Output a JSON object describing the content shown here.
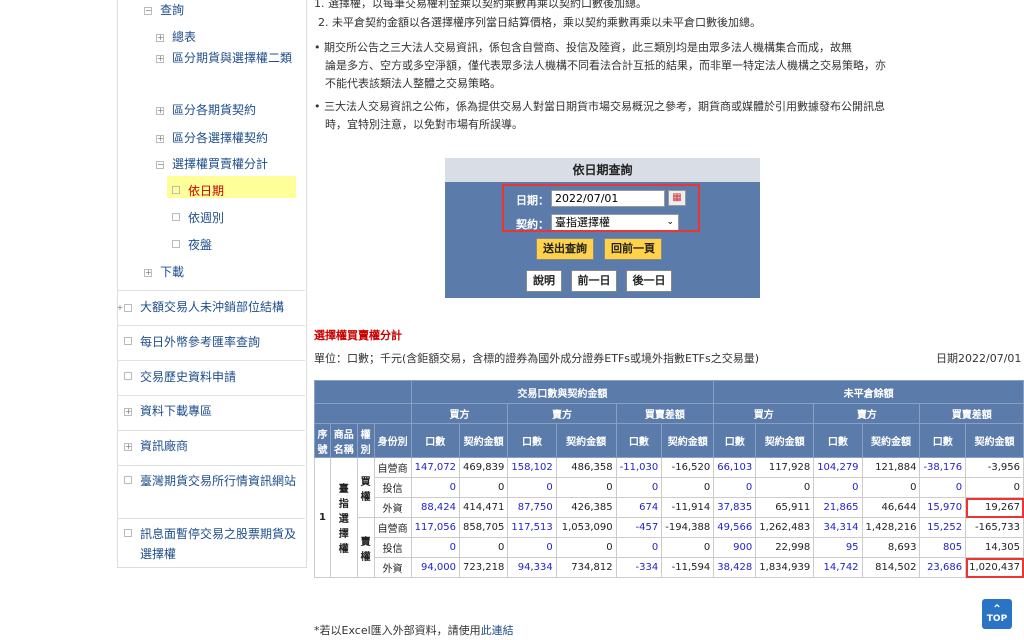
{
  "sidebar": {
    "items": [
      {
        "label": "查詢",
        "icon": "minus",
        "level": 1
      },
      {
        "label": "總表",
        "icon": "plus",
        "level": 2
      },
      {
        "label": "區分期貨與選擇權二類",
        "icon": "plus",
        "level": 2
      },
      {
        "label": "區分各期貨契約",
        "icon": "plus",
        "level": 2
      },
      {
        "label": "區分各選擇權契約",
        "icon": "plus",
        "level": 2
      },
      {
        "label": "選擇權買賣權分計",
        "icon": "minus",
        "level": 2
      },
      {
        "label": "依日期",
        "icon": "dot",
        "level": 3
      },
      {
        "label": "依週別",
        "icon": "dot",
        "level": 3
      },
      {
        "label": "夜盤",
        "icon": "dot",
        "level": 3
      },
      {
        "label": "下載",
        "icon": "plus",
        "level": 1
      },
      {
        "label": "大額交易人未沖銷部位結構",
        "icon": "plus",
        "level": 0
      },
      {
        "label": "每日外幣參考匯率查詢",
        "icon": "dot",
        "level": 0
      },
      {
        "label": "交易歷史資料申請",
        "icon": "dot",
        "level": 0
      },
      {
        "label": "資料下載專區",
        "icon": "plus",
        "level": 0
      },
      {
        "label": "資訊廠商",
        "icon": "plus",
        "level": 0
      },
      {
        "label": "臺灣期貨交易所行情資訊網站",
        "icon": "dot",
        "level": 0
      },
      {
        "label": "訊息面暫停交易之股票期貨及選擇權",
        "icon": "dot",
        "level": 0
      }
    ]
  },
  "notes": {
    "n1": "1. 選擇權，以每筆交易權利金乘以契約乘數再乘以契約口數後加總。",
    "n2": "2. 未平倉契約金額以各選擇權序列當日結算價格，乘以契約乘數再乘以未平倉口數後加總。",
    "n3a": "• 期交所公告之三大法人交易資訊，係包含自營商、投信及陸資，此三類別均是由眾多法人機構集合而成，故無",
    "n3b": "論是多方、空方或多空淨額，僅代表眾多法人機構不同看法合計互抵的結果，而非單一特定法人機構之交易策略，亦",
    "n3c": "不能代表該類法人整體之交易策略。",
    "n4a": "• 三大法人交易資訊之公佈，係為提供交易人對當日期貨市場交易概況之參考，期貨商或媒體於引用數據發布公開訊息",
    "n4b": "時，宜特別注意，以免對市場有所誤導。"
  },
  "query": {
    "title": "依日期查詢",
    "date_label": "日期：",
    "date_value": "2022/07/01",
    "contract_label": "契約：",
    "contract_value": "臺指選擇權",
    "submit": "送出查詢",
    "back": "回前一頁",
    "help": "說明",
    "prev_day": "前一日",
    "next_day": "後一日"
  },
  "section_title": "選擇權買賣權分計",
  "unit_text": "單位：口數；千元(含鉅額交易，含標的證券為國外成分證券ETFs或境外指數ETFs之交易量)",
  "date_text": "日期2022/07/01",
  "table": {
    "h_top": [
      "交易口數與契約金額",
      "未平倉餘額"
    ],
    "h_mid": [
      "買方",
      "賣方",
      "買賣差額",
      "買方",
      "賣方",
      "買賣差額"
    ],
    "h_left": [
      "序號",
      "商品名稱",
      "權別",
      "身份別"
    ],
    "h_sub": [
      "口數",
      "契約金額"
    ],
    "seq": "1",
    "product": "臺指選擇權",
    "call": "買權",
    "put": "賣權",
    "rows": [
      {
        "who": "自營商",
        "v": [
          "147,072",
          "469,839",
          "158,102",
          "486,358",
          "-11,030",
          "-16,520",
          "66,103",
          "117,928",
          "104,279",
          "121,884",
          "-38,176",
          "-3,956"
        ]
      },
      {
        "who": "投信",
        "v": [
          "0",
          "0",
          "0",
          "0",
          "0",
          "0",
          "0",
          "0",
          "0",
          "0",
          "0",
          "0"
        ]
      },
      {
        "who": "外資",
        "v": [
          "88,424",
          "414,471",
          "87,750",
          "426,385",
          "674",
          "-11,914",
          "37,835",
          "65,911",
          "21,865",
          "46,644",
          "15,970",
          "19,267"
        ]
      },
      {
        "who": "自營商",
        "v": [
          "117,056",
          "858,705",
          "117,513",
          "1,053,090",
          "-457",
          "-194,388",
          "49,566",
          "1,262,483",
          "34,314",
          "1,428,216",
          "15,252",
          "-165,733"
        ]
      },
      {
        "who": "投信",
        "v": [
          "0",
          "0",
          "0",
          "0",
          "0",
          "0",
          "900",
          "22,998",
          "95",
          "8,693",
          "805",
          "14,305"
        ]
      },
      {
        "who": "外資",
        "v": [
          "94,000",
          "723,218",
          "94,334",
          "734,812",
          "-334",
          "-11,594",
          "38,428",
          "1,834,939",
          "14,742",
          "814,502",
          "23,686",
          "1,020,437"
        ]
      }
    ]
  },
  "excel_note": "*若以Excel匯入外部資料，請使用",
  "excel_link": "此連結",
  "top_label": "TOP"
}
